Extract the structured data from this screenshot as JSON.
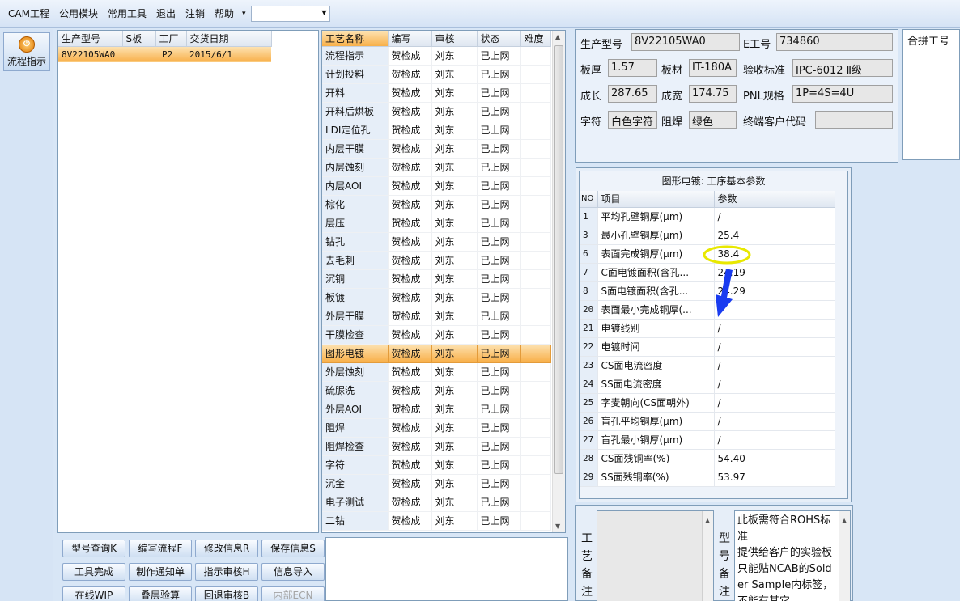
{
  "menu": {
    "items": [
      "CAM工程",
      "公用模块",
      "常用工具",
      "退出",
      "注销",
      "帮助"
    ],
    "help_arrow": "▾",
    "combo_value": ""
  },
  "leftbar": {
    "flow_button_label": "流程指示"
  },
  "product_table": {
    "headers": [
      "生产型号",
      "S板",
      "工厂",
      "交货日期"
    ],
    "rows": [
      {
        "model": "8V22105WA0",
        "s_board": "",
        "factory": "P2",
        "delivery": "2015/6/1",
        "selected": true
      }
    ]
  },
  "process_table": {
    "headers": [
      "工艺名称",
      "编写",
      "审核",
      "状态",
      "难度"
    ],
    "rows": [
      [
        "流程指示",
        "贺检成",
        "刘东",
        "已上网",
        ""
      ],
      [
        "计划投料",
        "贺检成",
        "刘东",
        "已上网",
        ""
      ],
      [
        "开料",
        "贺检成",
        "刘东",
        "已上网",
        ""
      ],
      [
        "开料后烘板",
        "贺检成",
        "刘东",
        "已上网",
        ""
      ],
      [
        "LDI定位孔",
        "贺检成",
        "刘东",
        "已上网",
        ""
      ],
      [
        "内层干膜",
        "贺检成",
        "刘东",
        "已上网",
        ""
      ],
      [
        "内层蚀刻",
        "贺检成",
        "刘东",
        "已上网",
        ""
      ],
      [
        "内层AOI",
        "贺检成",
        "刘东",
        "已上网",
        ""
      ],
      [
        "棕化",
        "贺检成",
        "刘东",
        "已上网",
        ""
      ],
      [
        "层压",
        "贺检成",
        "刘东",
        "已上网",
        ""
      ],
      [
        "钻孔",
        "贺检成",
        "刘东",
        "已上网",
        ""
      ],
      [
        "去毛刺",
        "贺检成",
        "刘东",
        "已上网",
        ""
      ],
      [
        "沉铜",
        "贺检成",
        "刘东",
        "已上网",
        ""
      ],
      [
        "板镀",
        "贺检成",
        "刘东",
        "已上网",
        ""
      ],
      [
        "外层干膜",
        "贺检成",
        "刘东",
        "已上网",
        ""
      ],
      [
        "干膜检查",
        "贺检成",
        "刘东",
        "已上网",
        ""
      ],
      [
        "图形电镀",
        "贺检成",
        "刘东",
        "已上网",
        ""
      ],
      [
        "外层蚀刻",
        "贺检成",
        "刘东",
        "已上网",
        ""
      ],
      [
        "硫脲洗",
        "贺检成",
        "刘东",
        "已上网",
        ""
      ],
      [
        "外层AOI",
        "贺检成",
        "刘东",
        "已上网",
        ""
      ],
      [
        "阻焊",
        "贺检成",
        "刘东",
        "已上网",
        ""
      ],
      [
        "阻焊检查",
        "贺检成",
        "刘东",
        "已上网",
        ""
      ],
      [
        "字符",
        "贺检成",
        "刘东",
        "已上网",
        ""
      ],
      [
        "沉金",
        "贺检成",
        "刘东",
        "已上网",
        ""
      ],
      [
        "电子测试",
        "贺检成",
        "刘东",
        "已上网",
        ""
      ],
      [
        "二钻",
        "贺检成",
        "刘东",
        "已上网",
        ""
      ]
    ],
    "selected_index": 16
  },
  "info": {
    "model_label": "生产型号",
    "model_value": "8V22105WA0",
    "eno_label": "E工号",
    "eno_value": "734860",
    "thickness_label": "板厚",
    "thickness_value": "1.57",
    "material_label": "板材",
    "material_value": "IT-180A",
    "standard_label": "验收标准",
    "standard_value": "IPC-6012 Ⅱ级",
    "length_label": "成长",
    "length_value": "287.65",
    "width_label": "成宽",
    "width_value": "174.75",
    "pnl_label": "PNL规格",
    "pnl_value": "1P=4S=4U",
    "char_label": "字符",
    "char_value": "白色字符",
    "mask_label": "阻焊",
    "mask_value": "绿色",
    "customer_label": "终端客户代码",
    "customer_value": ""
  },
  "merge": {
    "label": "合拼工号"
  },
  "params": {
    "title": "图形电镀: 工序基本参数",
    "headers": [
      "NO",
      "项目",
      "参数"
    ],
    "rows": [
      [
        "1",
        "平均孔壁铜厚(μm)",
        "/"
      ],
      [
        "3",
        "最小孔壁铜厚(μm)",
        "25.4"
      ],
      [
        "6",
        "表面完成铜厚(μm)",
        "38.4"
      ],
      [
        "7",
        "C面电镀面积(含孔...",
        "24.19"
      ],
      [
        "8",
        "S面电镀面积(含孔...",
        "24.29"
      ],
      [
        "20",
        "表面最小完成铜厚(...",
        "/"
      ],
      [
        "21",
        "电镀线别",
        "/"
      ],
      [
        "22",
        "电镀时间",
        "/"
      ],
      [
        "23",
        "CS面电流密度",
        "/"
      ],
      [
        "24",
        "SS面电流密度",
        "/"
      ],
      [
        "25",
        "字麦朝向(CS面朝外)",
        "/"
      ],
      [
        "26",
        "盲孔平均铜厚(μm)",
        "/"
      ],
      [
        "27",
        "盲孔最小铜厚(μm)",
        "/"
      ],
      [
        "28",
        "CS面残铜率(%)",
        "54.40"
      ],
      [
        "29",
        "SS面残铜率(%)",
        "53.97"
      ]
    ]
  },
  "buttons": {
    "model_query": "型号查询K",
    "edit_flow": "编写流程F",
    "modify_info": "修改信息R",
    "save_info": "保存信息S",
    "tool_done": "工具完成",
    "make_notice": "制作通知单",
    "instr_review": "指示审核H",
    "info_import": "信息导入",
    "online_wip": "在线WIP",
    "stack_calc": "叠层验算",
    "return_review": "回退审核B",
    "internal_ecn": "内部ECN"
  },
  "memo": {
    "process_label": "工艺备注",
    "model_label": "型号备注",
    "model_text": "此板需符合ROHS标准\n提供给客户的实验板只能贴NCAB的Solder Sample内标签，不能有其它"
  },
  "colors": {
    "selection": "#f8b04a",
    "annot_ellipse": "#e8e800",
    "annot_arrow": "#1a3cf0"
  }
}
